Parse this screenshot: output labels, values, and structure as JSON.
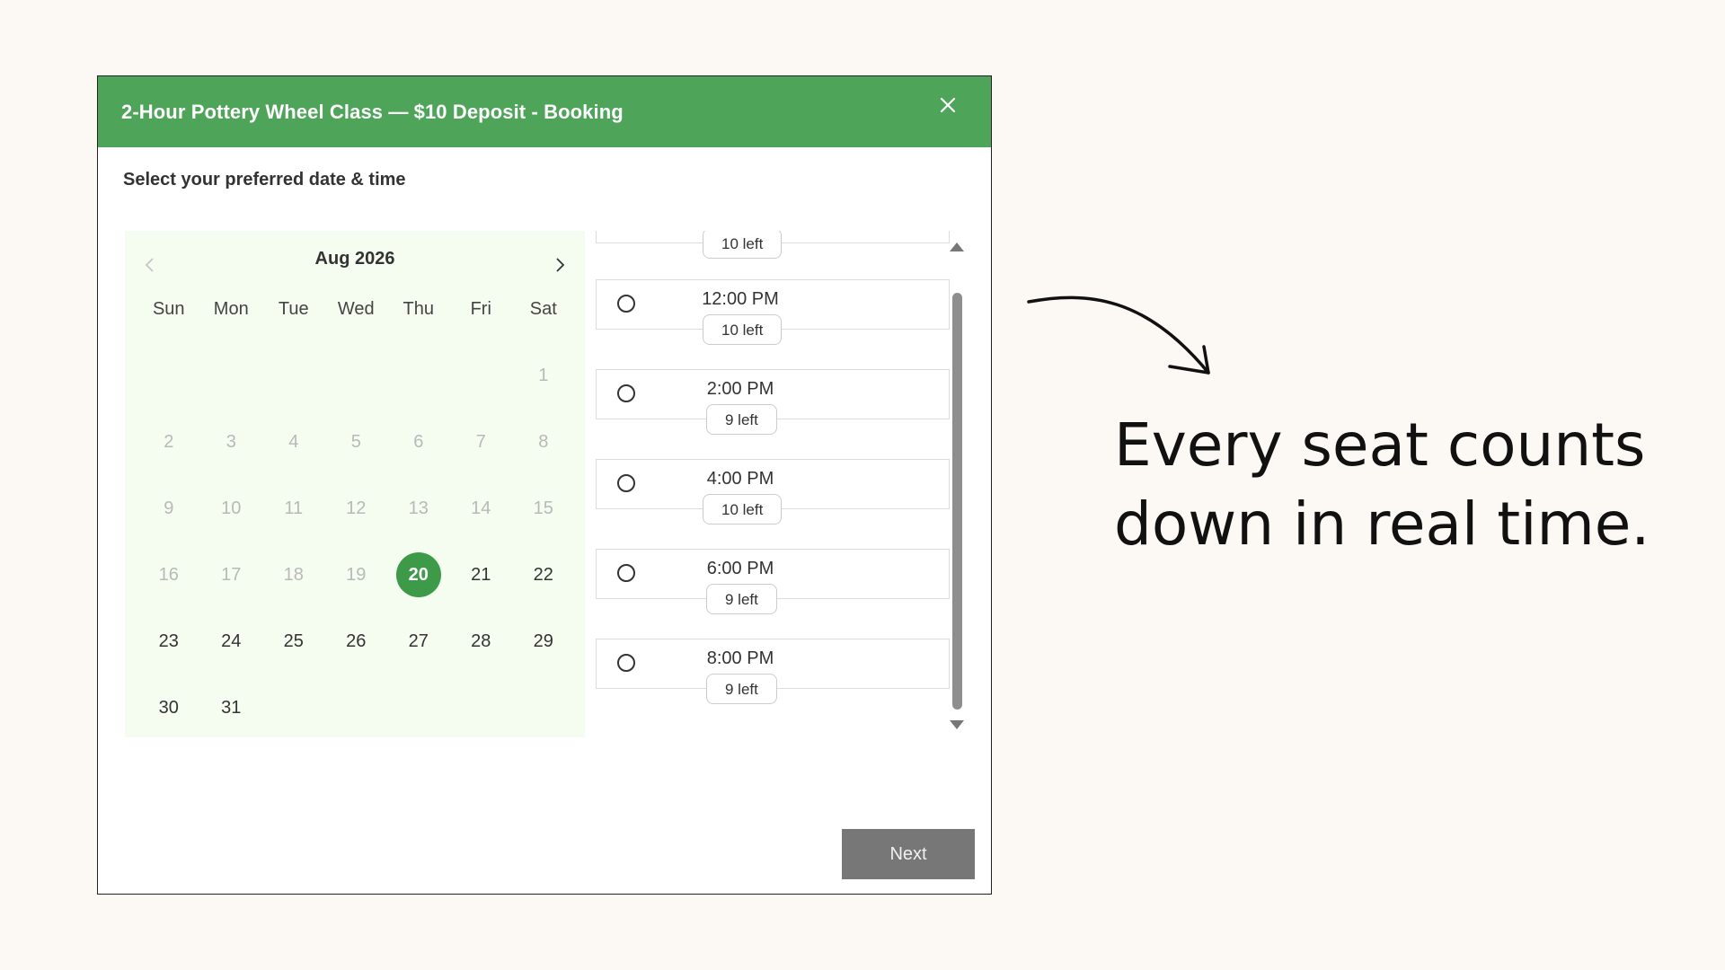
{
  "modal": {
    "title": "2-Hour Pottery Wheel Class — $10 Deposit - Booking",
    "close_icon": "close-icon",
    "subtitle": "Select your preferred date & time"
  },
  "calendar": {
    "month_label": "Aug 2026",
    "prev_icon": "chevron-left-icon",
    "next_icon": "chevron-right-icon",
    "weekdays": [
      "Sun",
      "Mon",
      "Tue",
      "Wed",
      "Thu",
      "Fri",
      "Sat"
    ],
    "selected_day": "20",
    "weeks": [
      [
        "",
        "",
        "",
        "",
        "",
        "",
        "1"
      ],
      [
        "2",
        "3",
        "4",
        "5",
        "6",
        "7",
        "8"
      ],
      [
        "9",
        "10",
        "11",
        "12",
        "13",
        "14",
        "15"
      ],
      [
        "16",
        "17",
        "18",
        "19",
        "20",
        "21",
        "22"
      ],
      [
        "23",
        "24",
        "25",
        "26",
        "27",
        "28",
        "29"
      ],
      [
        "30",
        "31",
        "",
        "",
        "",
        "",
        ""
      ]
    ]
  },
  "slots": {
    "partial_badge": "10 left",
    "items": [
      {
        "time": "12:00 PM",
        "availability": "10 left"
      },
      {
        "time": "2:00 PM",
        "availability": "9 left"
      },
      {
        "time": "4:00 PM",
        "availability": "10 left"
      },
      {
        "time": "6:00 PM",
        "availability": "9 left"
      },
      {
        "time": "8:00 PM",
        "availability": "9 left"
      }
    ]
  },
  "actions": {
    "next_label": "Next"
  },
  "annotation": {
    "line1": "Every seat counts",
    "line2": "down in real time.",
    "arrow_icon": "curved-arrow-icon"
  },
  "colors": {
    "header": "#4ea458",
    "selected_day": "#3c9a48",
    "calendar_bg": "#f5fcf0",
    "next_button": "#777777",
    "page_bg": "#fcf8f4"
  }
}
